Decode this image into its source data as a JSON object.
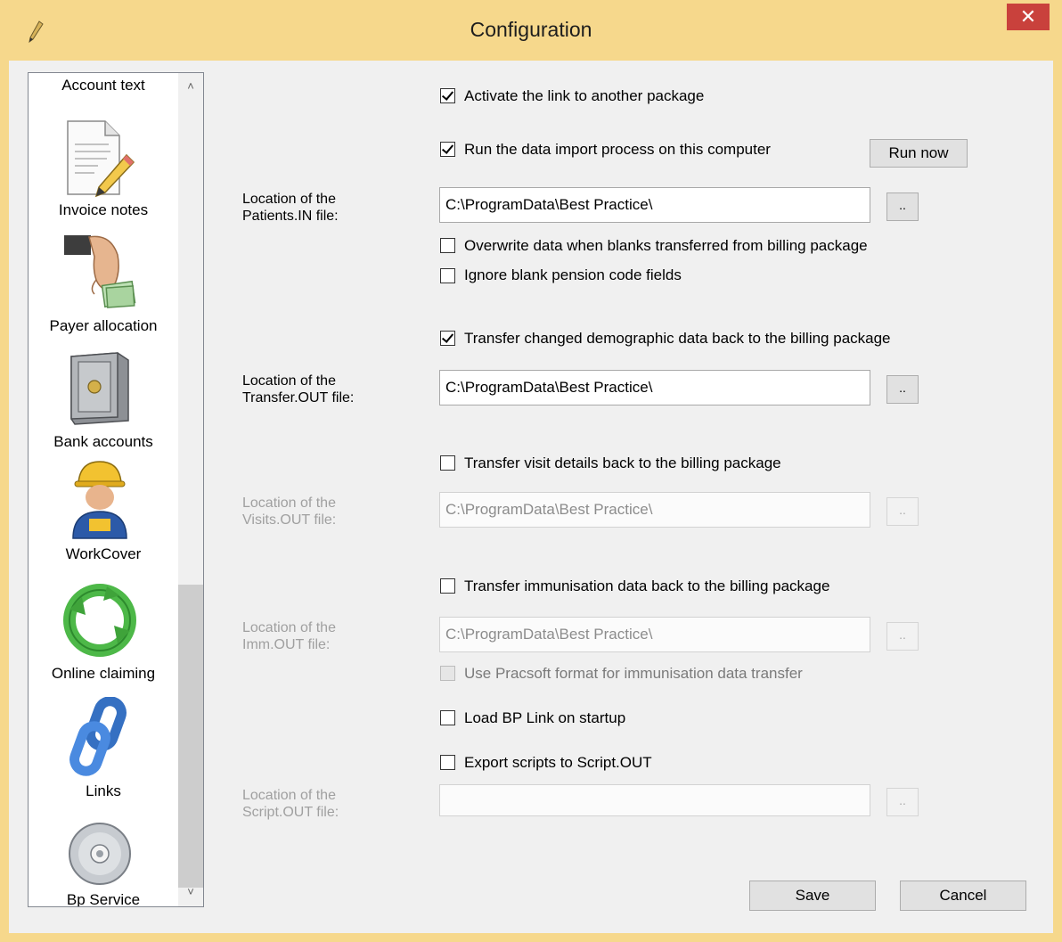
{
  "window": {
    "title": "Configuration",
    "close_glyph": "✕",
    "app_icon": "pen-icon"
  },
  "sidebar": {
    "items": [
      {
        "label": "Account text",
        "icon": "none"
      },
      {
        "label": "Invoice notes",
        "icon": "document-pencil-icon"
      },
      {
        "label": "Payer allocation",
        "icon": "hand-money-icon"
      },
      {
        "label": "Bank accounts",
        "icon": "safe-icon"
      },
      {
        "label": "WorkCover",
        "icon": "worker-icon"
      },
      {
        "label": "Online claiming",
        "icon": "recycle-arrows-icon"
      },
      {
        "label": "Links",
        "icon": "chain-link-icon",
        "selected": true
      },
      {
        "label": "Bp Service",
        "icon": "disc-icon"
      }
    ],
    "scroll_up": "˄",
    "scroll_down": "˅"
  },
  "options": {
    "activate_link": {
      "label": "Activate the link to another package",
      "checked": true
    },
    "run_import": {
      "label": "Run the data import process on this computer",
      "checked": true
    },
    "run_now_label": "Run now",
    "patients_in": {
      "label_line1": "Location of the",
      "label_line2": "Patients.IN file:",
      "path": "C:\\ProgramData\\Best Practice\\",
      "browse": ".."
    },
    "overwrite_blanks": {
      "label": "Overwrite data when blanks transferred from billing package",
      "checked": false
    },
    "ignore_pension": {
      "label": "Ignore blank pension code fields",
      "checked": false
    },
    "transfer_demographic": {
      "label": "Transfer changed demographic data back to the billing package",
      "checked": true
    },
    "transfer_out": {
      "label_line1": "Location of the",
      "label_line2": "Transfer.OUT file:",
      "path": "C:\\ProgramData\\Best Practice\\",
      "browse": ".."
    },
    "transfer_visits": {
      "label": "Transfer visit details back to the billing package",
      "checked": false
    },
    "visits_out": {
      "label_line1": "Location of the",
      "label_line2": "Visits.OUT file:",
      "path": "C:\\ProgramData\\Best Practice\\",
      "browse": ".."
    },
    "transfer_imm": {
      "label": "Transfer immunisation data back to the billing package",
      "checked": false
    },
    "imm_out": {
      "label_line1": "Location of the",
      "label_line2": "Imm.OUT file:",
      "path": "C:\\ProgramData\\Best Practice\\",
      "browse": ".."
    },
    "pracsoft_format": {
      "label": "Use Pracsoft format for immunisation data transfer",
      "checked": false
    },
    "load_bp_link": {
      "label": "Load BP Link on startup",
      "checked": false
    },
    "export_scripts": {
      "label": "Export scripts to Script.OUT",
      "checked": false
    },
    "script_out": {
      "label_line1": "Location of the",
      "label_line2": "Script.OUT file:",
      "path": "",
      "browse": ".."
    }
  },
  "footer": {
    "save_label": "Save",
    "cancel_label": "Cancel"
  }
}
